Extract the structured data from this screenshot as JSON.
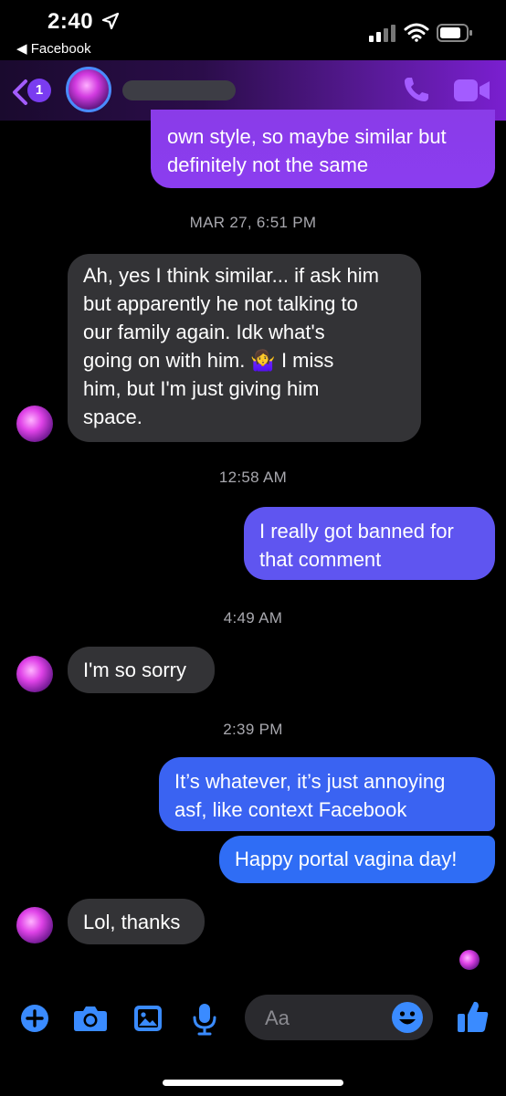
{
  "status_bar": {
    "time": "2:40",
    "back_app": "◀ Facebook"
  },
  "header": {
    "unread_count": "1",
    "contact_name": "",
    "icons": [
      "back-chevron-icon",
      "phone-icon",
      "video-camera-icon"
    ],
    "accent": "#a35cff"
  },
  "messages": [
    {
      "type": "out",
      "lines": [
        "own style, so maybe similar but",
        "definitely not the same"
      ]
    },
    {
      "type": "timestamp",
      "text": "MAR 27, 6:51 PM"
    },
    {
      "type": "in",
      "lines": [
        "Ah, yes I think similar... if ask him",
        "but apparently he not talking to",
        "our family again. Idk what's",
        "going on with him. 🤷‍♀️ I miss",
        "him, but I'm just giving him",
        "space."
      ]
    },
    {
      "type": "timestamp",
      "text": "12:58 AM"
    },
    {
      "type": "out",
      "lines": [
        "I really got banned for",
        "that comment"
      ]
    },
    {
      "type": "timestamp",
      "text": "4:49 AM"
    },
    {
      "type": "in",
      "lines": [
        "I'm so sorry"
      ]
    },
    {
      "type": "timestamp",
      "text": "2:39 PM"
    },
    {
      "type": "out",
      "lines": [
        "It’s whatever, it’s just annoying",
        "asf, like context Facebook"
      ]
    },
    {
      "type": "out",
      "lines": [
        "Happy portal vagina day!"
      ]
    },
    {
      "type": "in",
      "lines": [
        "Lol, thanks"
      ]
    }
  ],
  "composer": {
    "placeholder": "Aa",
    "icons": [
      "plus-icon",
      "camera-icon",
      "photo-icon",
      "microphone-icon",
      "emoji-icon",
      "thumbs-up-icon"
    ],
    "icon_color": "#3a8bff"
  },
  "colors": {
    "incoming_bubble": "#333336",
    "outgoing_purple": "#8a3cf0",
    "outgoing_indigo": "#5f55f0",
    "outgoing_blue": "#2f6df5",
    "timestamp": "#a8a8ae"
  }
}
